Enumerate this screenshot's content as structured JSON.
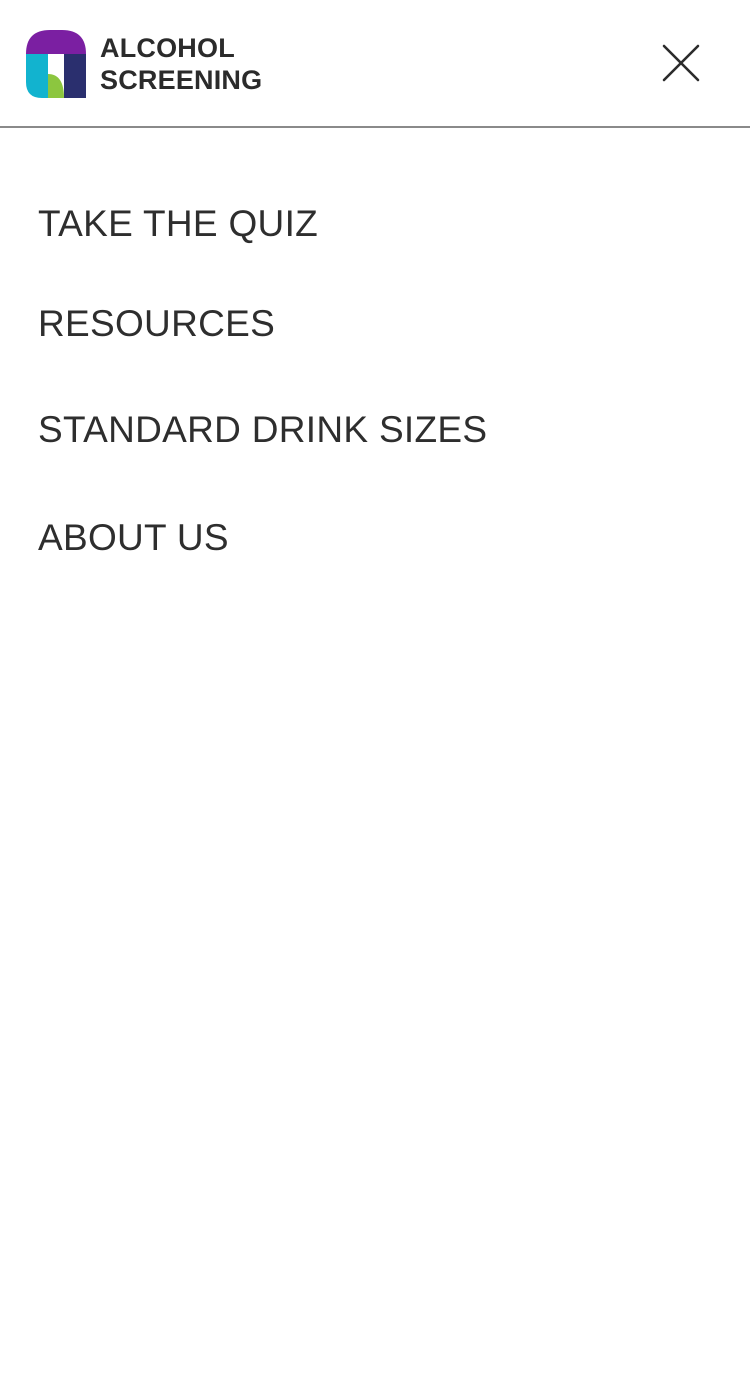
{
  "header": {
    "brand_line1": "ALCOHOL",
    "brand_line2": "SCREENING",
    "logo_icon": "alcohol-screening-logo-icon",
    "close_icon": "close-icon"
  },
  "colors": {
    "logo_purple": "#7b1fa2",
    "logo_cyan": "#12b3cf",
    "logo_navy": "#2a2f6e",
    "logo_green": "#8cc63f",
    "text": "#2e2e2e",
    "divider": "#8a8a8a"
  },
  "nav": {
    "items": [
      {
        "label": "TAKE THE QUIZ"
      },
      {
        "label": "RESOURCES"
      },
      {
        "label": "STANDARD DRINK SIZES"
      },
      {
        "label": "ABOUT US"
      }
    ]
  }
}
